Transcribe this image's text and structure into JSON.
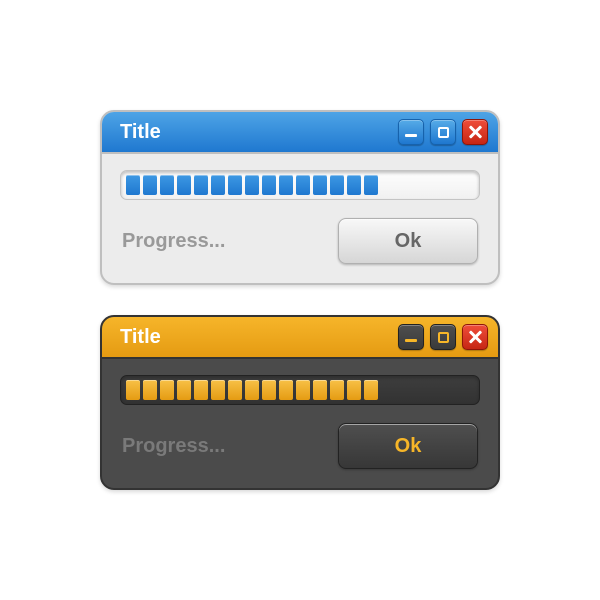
{
  "windows": [
    {
      "title": "Title",
      "status": "Progress...",
      "ok_label": "Ok",
      "segments": 15,
      "theme": "light",
      "accent": "#1f78d0"
    },
    {
      "title": "Title",
      "status": "Progress...",
      "ok_label": "Ok",
      "segments": 15,
      "theme": "dark",
      "accent": "#e59b12"
    }
  ]
}
